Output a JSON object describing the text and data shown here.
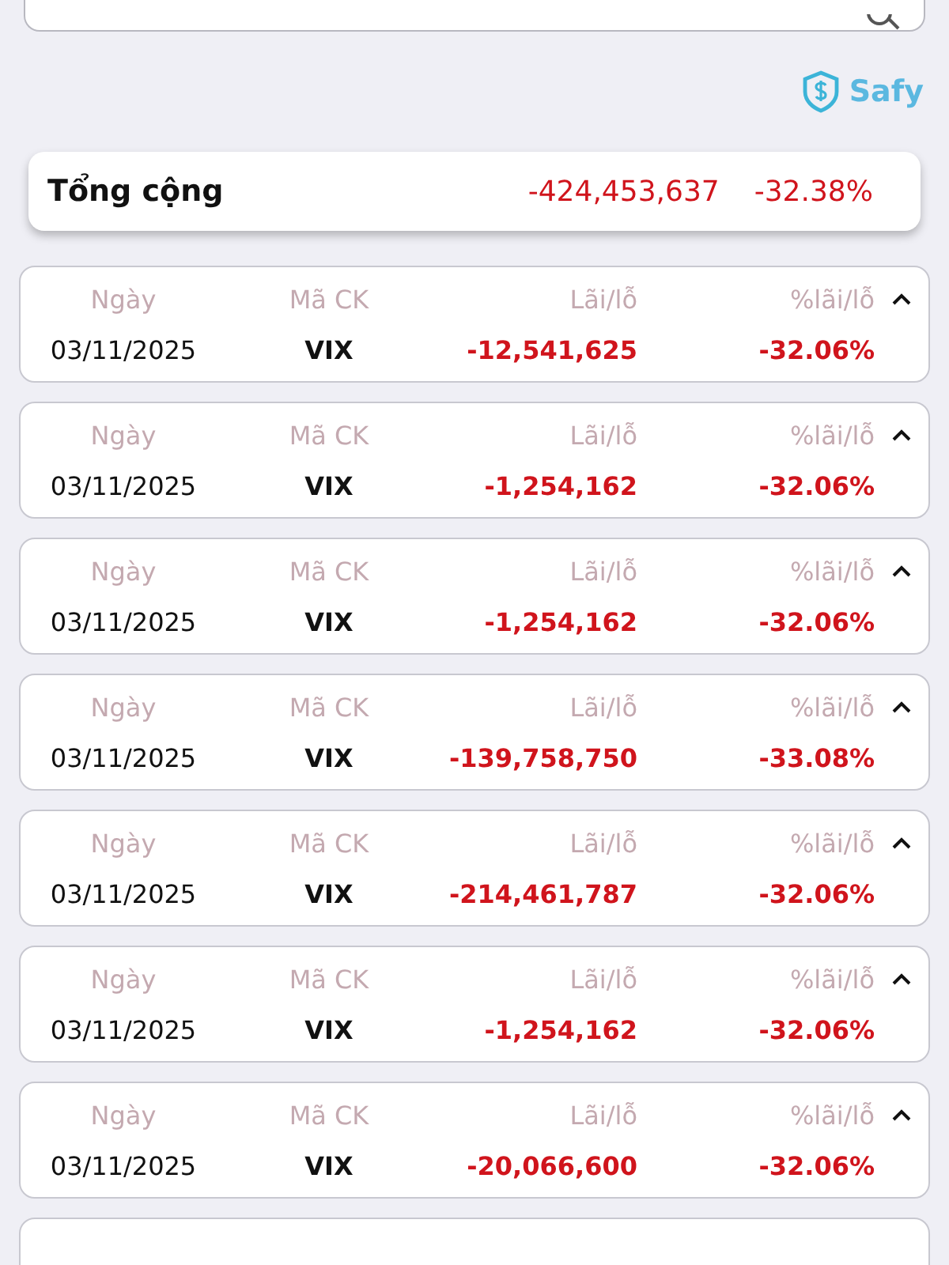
{
  "brand": {
    "name": "Safy"
  },
  "total": {
    "label": "Tổng cộng",
    "amount": "-424,453,637",
    "percent": "-32.38%"
  },
  "rows": [
    {
      "headers": [
        "Ngày",
        "Mã CK",
        "Lãi/lỗ",
        "%lãi/lỗ"
      ],
      "date": "03/11/2025",
      "symbol": "VIX",
      "amount": "-12,541,625",
      "percent": "-32.06%",
      "expanded": true
    },
    {
      "headers": [
        "Ngày",
        "Mã CK",
        "Lãi/lỗ",
        "%lãi/lỗ"
      ],
      "date": "03/11/2025",
      "symbol": "VIX",
      "amount": "-1,254,162",
      "percent": "-32.06%",
      "expanded": true
    },
    {
      "headers": [
        "Ngày",
        "Mã CK",
        "Lãi/lỗ",
        "%lãi/lỗ"
      ],
      "date": "03/11/2025",
      "symbol": "VIX",
      "amount": "-1,254,162",
      "percent": "-32.06%",
      "expanded": true
    },
    {
      "headers": [
        "Ngày",
        "Mã CK",
        "Lãi/lỗ",
        "%lãi/lỗ"
      ],
      "date": "03/11/2025",
      "symbol": "VIX",
      "amount": "-139,758,750",
      "percent": "-33.08%",
      "expanded": true
    },
    {
      "headers": [
        "Ngày",
        "Mã CK",
        "Lãi/lỗ",
        "%lãi/lỗ"
      ],
      "date": "03/11/2025",
      "symbol": "VIX",
      "amount": "-214,461,787",
      "percent": "-32.06%",
      "expanded": true
    },
    {
      "headers": [
        "Ngày",
        "Mã CK",
        "Lãi/lỗ",
        "%lãi/lỗ"
      ],
      "date": "03/11/2025",
      "symbol": "VIX",
      "amount": "-1,254,162",
      "percent": "-32.06%",
      "expanded": true
    },
    {
      "headers": [
        "Ngày",
        "Mã CK",
        "Lãi/lỗ",
        "%lãi/lỗ"
      ],
      "date": "03/11/2025",
      "symbol": "VIX",
      "amount": "-20,066,600",
      "percent": "-32.06%",
      "expanded": true
    }
  ]
}
